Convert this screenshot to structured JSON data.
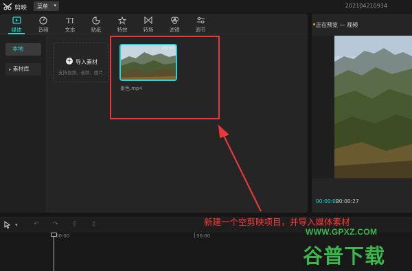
{
  "app": {
    "name": "剪映",
    "menu_label": "菜单",
    "project_name": "202104210934"
  },
  "toolbar": {
    "tools": [
      {
        "label": "媒体",
        "icon": "media-icon"
      },
      {
        "label": "音频",
        "icon": "audio-icon"
      },
      {
        "label": "文本",
        "icon": "text-icon",
        "glyph": "TI"
      },
      {
        "label": "贴纸",
        "icon": "sticker-icon"
      },
      {
        "label": "特效",
        "icon": "effects-icon"
      },
      {
        "label": "转场",
        "icon": "transition-icon"
      },
      {
        "label": "滤镜",
        "icon": "filter-icon"
      },
      {
        "label": "调节",
        "icon": "adjust-icon"
      }
    ],
    "active_index": 0
  },
  "sidebar": {
    "local": "本地",
    "library": "素材库"
  },
  "import": {
    "label": "导入素材",
    "sub": "支持视频、音频、图片"
  },
  "clip": {
    "name": "景色.mp4",
    "duration": "00:00"
  },
  "preview": {
    "title": "正在预览 — 视频",
    "current": "00:00:02",
    "total": "00:00:27"
  },
  "timeline": {
    "ticks": [
      "00:00",
      "30:00"
    ]
  },
  "annotation": "新建一个空剪映项目，并导入媒体素材",
  "watermark": {
    "url": "WWW.GPXZ.COM",
    "name": "谷普下载"
  },
  "colors": {
    "accent": "#2fd4d4",
    "annotation": "#e43a3a",
    "watermark": "#3ab84a"
  }
}
